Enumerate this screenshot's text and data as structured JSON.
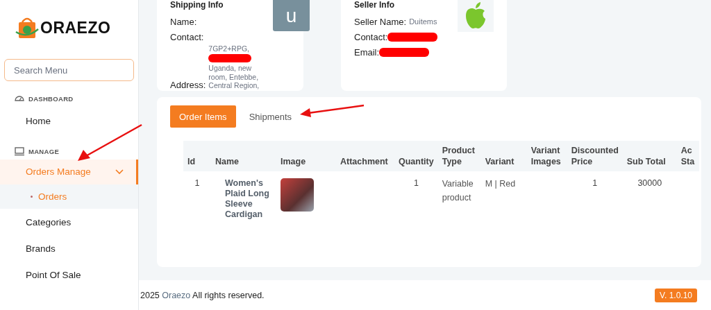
{
  "brand": {
    "name": "ORAEZO"
  },
  "search": {
    "placeholder": "Search Menu"
  },
  "sidebar": {
    "sections": [
      {
        "title": "DASHBOARD",
        "items": [
          {
            "label": "Home",
            "selected": false
          }
        ]
      },
      {
        "title": "MANAGE",
        "items": [
          {
            "label": "Orders Manage",
            "selected": true,
            "expanded": true,
            "children": [
              {
                "label": "Orders",
                "selected": true
              }
            ]
          },
          {
            "label": "Categories",
            "selected": false
          },
          {
            "label": "Brands",
            "selected": false
          },
          {
            "label": "Point Of Sale",
            "selected": false
          }
        ]
      }
    ]
  },
  "shipping_info": {
    "title": "Shipping Info",
    "avatar": "u",
    "fields": [
      {
        "label": "Name:"
      },
      {
        "label": "Contact:"
      },
      {
        "label": "Address:",
        "lines": [
          {
            "text": "7GP2+RPG,"
          },
          {
            "redacted": true
          },
          {
            "text": "Uganda, new room, Entebbe, Central Region,"
          }
        ]
      }
    ]
  },
  "seller_info": {
    "title": "Seller Info",
    "fields": [
      {
        "label": "Seller Name:",
        "value": "Duitems"
      },
      {
        "label": "Contact:",
        "redacted": true
      },
      {
        "label": "Email:",
        "redacted": true
      }
    ]
  },
  "tabs": [
    {
      "label": "Order Items",
      "selected": true
    },
    {
      "label": "Shipments",
      "selected": false
    }
  ],
  "table": {
    "columns": [
      "Id",
      "Name",
      "Image",
      "Attachment",
      "Quantity",
      "Product Type",
      "Variant",
      "Variant Images",
      "Discounted Price",
      "Sub Total",
      "Ac Sta"
    ],
    "rows": [
      {
        "id": "1",
        "name": "Women's Plaid Long Sleeve Cardigan",
        "quantity": "1",
        "product_type": "Variable product",
        "variant": "M | Red",
        "discounted_price": "1",
        "sub_total": "30000"
      }
    ]
  },
  "footer": {
    "year": "2025",
    "link": "Oraezo",
    "text": "All rights reserved.",
    "version": "V. 1.0.10"
  }
}
